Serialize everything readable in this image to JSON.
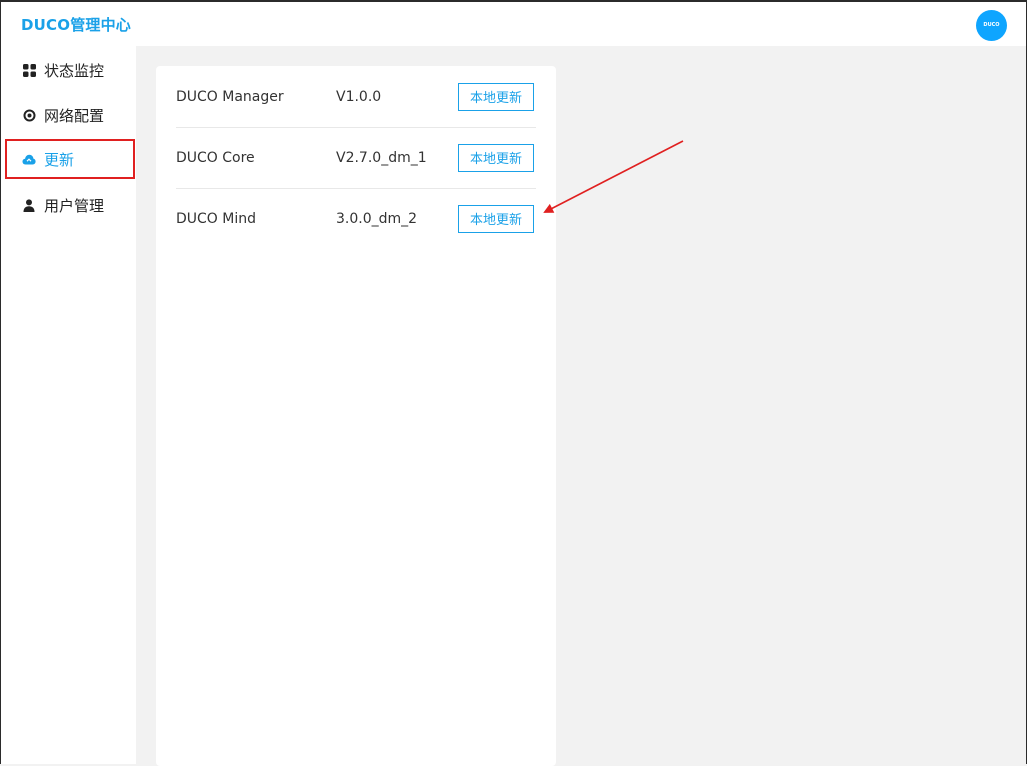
{
  "header": {
    "title": "DUCO管理中心",
    "avatar_text": "DUCO"
  },
  "sidebar": {
    "items": [
      {
        "label": "状态监控",
        "icon": "grid-icon"
      },
      {
        "label": "网络配置",
        "icon": "target-icon"
      },
      {
        "label": "更新",
        "icon": "cloud-icon",
        "active": true
      },
      {
        "label": "用户管理",
        "icon": "user-icon"
      }
    ]
  },
  "updates": {
    "rows": [
      {
        "name": "DUCO Manager",
        "version": "V1.0.0",
        "button": "本地更新"
      },
      {
        "name": "DUCO Core",
        "version": "V2.7.0_dm_1",
        "button": "本地更新"
      },
      {
        "name": "DUCO Mind",
        "version": "3.0.0_dm_2",
        "button": "本地更新"
      }
    ]
  },
  "colors": {
    "accent": "#1aa1e8",
    "highlight": "#e02020",
    "avatar": "#0ea5ff"
  }
}
